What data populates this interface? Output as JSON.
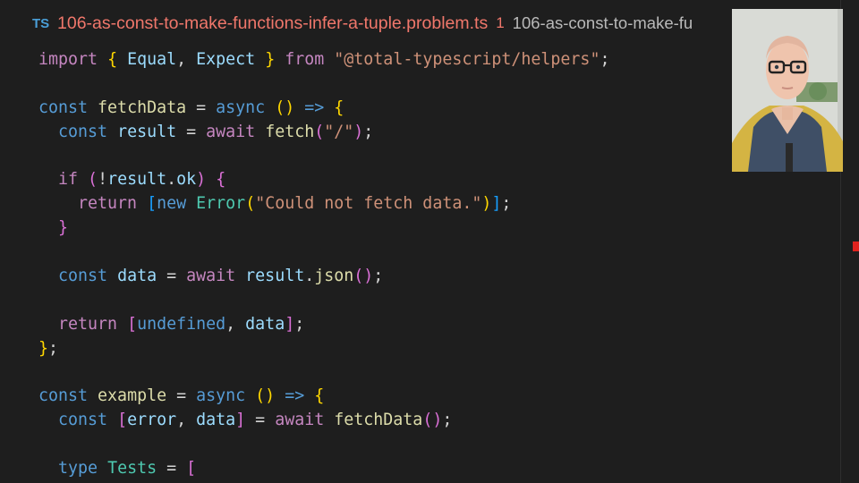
{
  "tab": {
    "lang_badge": "TS",
    "filename": "106-as-const-to-make-functions-infer-a-tuple.problem.ts",
    "problem_count": "1",
    "breadcrumb": "106-as-const-to-make-fu"
  },
  "code": {
    "lines": [
      [
        {
          "c": "kc",
          "t": "import"
        },
        {
          "c": "p",
          "t": " "
        },
        {
          "c": "b1",
          "t": "{"
        },
        {
          "c": "p",
          "t": " "
        },
        {
          "c": "v",
          "t": "Equal"
        },
        {
          "c": "p",
          "t": ", "
        },
        {
          "c": "v",
          "t": "Expect"
        },
        {
          "c": "p",
          "t": " "
        },
        {
          "c": "b1",
          "t": "}"
        },
        {
          "c": "p",
          "t": " "
        },
        {
          "c": "kc",
          "t": "from"
        },
        {
          "c": "p",
          "t": " "
        },
        {
          "c": "s",
          "t": "\"@total-typescript/helpers\""
        },
        {
          "c": "p",
          "t": ";"
        }
      ],
      [],
      [
        {
          "c": "k",
          "t": "const"
        },
        {
          "c": "p",
          "t": " "
        },
        {
          "c": "f",
          "t": "fetchData"
        },
        {
          "c": "p",
          "t": " = "
        },
        {
          "c": "k",
          "t": "async"
        },
        {
          "c": "p",
          "t": " "
        },
        {
          "c": "b1",
          "t": "()"
        },
        {
          "c": "p",
          "t": " "
        },
        {
          "c": "k",
          "t": "=>"
        },
        {
          "c": "p",
          "t": " "
        },
        {
          "c": "b1",
          "t": "{"
        }
      ],
      [
        {
          "c": "p",
          "t": "  "
        },
        {
          "c": "k",
          "t": "const"
        },
        {
          "c": "p",
          "t": " "
        },
        {
          "c": "v",
          "t": "result"
        },
        {
          "c": "p",
          "t": " = "
        },
        {
          "c": "kc",
          "t": "await"
        },
        {
          "c": "p",
          "t": " "
        },
        {
          "c": "f",
          "t": "fetch"
        },
        {
          "c": "b2",
          "t": "("
        },
        {
          "c": "s",
          "t": "\"/\""
        },
        {
          "c": "b2",
          "t": ")"
        },
        {
          "c": "p",
          "t": ";"
        }
      ],
      [],
      [
        {
          "c": "p",
          "t": "  "
        },
        {
          "c": "kc",
          "t": "if"
        },
        {
          "c": "p",
          "t": " "
        },
        {
          "c": "b2",
          "t": "("
        },
        {
          "c": "p",
          "t": "!"
        },
        {
          "c": "v",
          "t": "result"
        },
        {
          "c": "p",
          "t": "."
        },
        {
          "c": "v",
          "t": "ok"
        },
        {
          "c": "b2",
          "t": ")"
        },
        {
          "c": "p",
          "t": " "
        },
        {
          "c": "b2",
          "t": "{"
        }
      ],
      [
        {
          "c": "p",
          "t": "    "
        },
        {
          "c": "kc",
          "t": "return"
        },
        {
          "c": "p",
          "t": " "
        },
        {
          "c": "b3",
          "t": "["
        },
        {
          "c": "k",
          "t": "new"
        },
        {
          "c": "p",
          "t": " "
        },
        {
          "c": "t",
          "t": "Error"
        },
        {
          "c": "b1",
          "t": "("
        },
        {
          "c": "s",
          "t": "\"Could not fetch data.\""
        },
        {
          "c": "b1",
          "t": ")"
        },
        {
          "c": "b3",
          "t": "]"
        },
        {
          "c": "p",
          "t": ";"
        }
      ],
      [
        {
          "c": "p",
          "t": "  "
        },
        {
          "c": "b2",
          "t": "}"
        }
      ],
      [],
      [
        {
          "c": "p",
          "t": "  "
        },
        {
          "c": "k",
          "t": "const"
        },
        {
          "c": "p",
          "t": " "
        },
        {
          "c": "v",
          "t": "data"
        },
        {
          "c": "p",
          "t": " = "
        },
        {
          "c": "kc",
          "t": "await"
        },
        {
          "c": "p",
          "t": " "
        },
        {
          "c": "v",
          "t": "result"
        },
        {
          "c": "p",
          "t": "."
        },
        {
          "c": "f",
          "t": "json"
        },
        {
          "c": "b2",
          "t": "()"
        },
        {
          "c": "p",
          "t": ";"
        }
      ],
      [],
      [
        {
          "c": "p",
          "t": "  "
        },
        {
          "c": "kc",
          "t": "return"
        },
        {
          "c": "p",
          "t": " "
        },
        {
          "c": "b2",
          "t": "["
        },
        {
          "c": "k",
          "t": "undefined"
        },
        {
          "c": "p",
          "t": ", "
        },
        {
          "c": "v",
          "t": "data"
        },
        {
          "c": "b2",
          "t": "]"
        },
        {
          "c": "p",
          "t": ";"
        }
      ],
      [
        {
          "c": "b1",
          "t": "}"
        },
        {
          "c": "p",
          "t": ";"
        }
      ],
      [],
      [
        {
          "c": "k",
          "t": "const"
        },
        {
          "c": "p",
          "t": " "
        },
        {
          "c": "f",
          "t": "example"
        },
        {
          "c": "p",
          "t": " = "
        },
        {
          "c": "k",
          "t": "async"
        },
        {
          "c": "p",
          "t": " "
        },
        {
          "c": "b1",
          "t": "()"
        },
        {
          "c": "p",
          "t": " "
        },
        {
          "c": "k",
          "t": "=>"
        },
        {
          "c": "p",
          "t": " "
        },
        {
          "c": "b1",
          "t": "{"
        }
      ],
      [
        {
          "c": "p",
          "t": "  "
        },
        {
          "c": "k",
          "t": "const"
        },
        {
          "c": "p",
          "t": " "
        },
        {
          "c": "b2",
          "t": "["
        },
        {
          "c": "v",
          "t": "error"
        },
        {
          "c": "p",
          "t": ", "
        },
        {
          "c": "v",
          "t": "data"
        },
        {
          "c": "b2",
          "t": "]"
        },
        {
          "c": "p",
          "t": " = "
        },
        {
          "c": "kc",
          "t": "await"
        },
        {
          "c": "p",
          "t": " "
        },
        {
          "c": "f",
          "t": "fetchData"
        },
        {
          "c": "b2",
          "t": "()"
        },
        {
          "c": "p",
          "t": ";"
        }
      ],
      [],
      [
        {
          "c": "p",
          "t": "  "
        },
        {
          "c": "k",
          "t": "type"
        },
        {
          "c": "p",
          "t": " "
        },
        {
          "c": "t",
          "t": "Tests"
        },
        {
          "c": "p",
          "t": " = "
        },
        {
          "c": "b2",
          "t": "["
        }
      ]
    ]
  },
  "colors": {
    "background": "#1e1e1e",
    "tab_error": "#f0776b",
    "scroll_error_marker": "#e0231e"
  }
}
